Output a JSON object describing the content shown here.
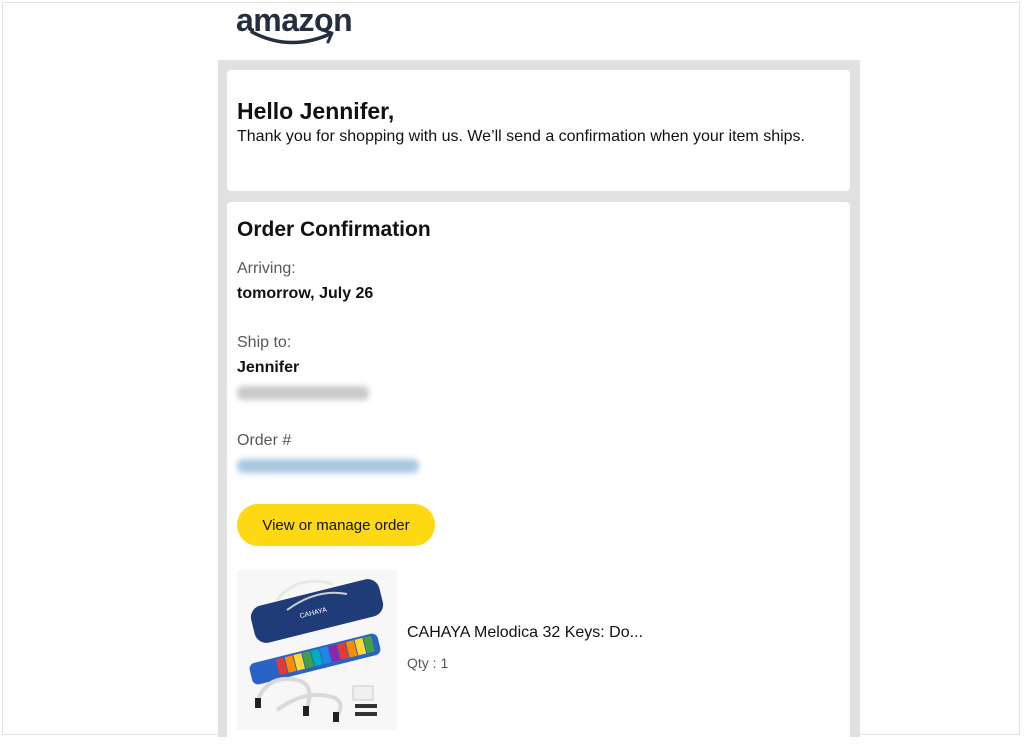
{
  "brand": {
    "logo_text": "amazon",
    "accent": "#ff9900",
    "dark": "#232f3e"
  },
  "greeting": {
    "title": "Hello Jennifer,",
    "message": "Thank you for shopping with us. We’ll send a confirmation when your item ships."
  },
  "order": {
    "title": "Order Confirmation",
    "arriving_label": "Arriving:",
    "arriving_value": "tomorrow, July 26",
    "ship_to_label": "Ship to:",
    "ship_to_name": "Jennifer",
    "order_label": "Order #",
    "manage_button": "View or manage order",
    "button_color": "#ffd814"
  },
  "items": [
    {
      "name": "CAHAYA Melodica 32 Keys: Do...",
      "qty": "Qty : 1",
      "image_icon": "melodica-product-image"
    }
  ]
}
